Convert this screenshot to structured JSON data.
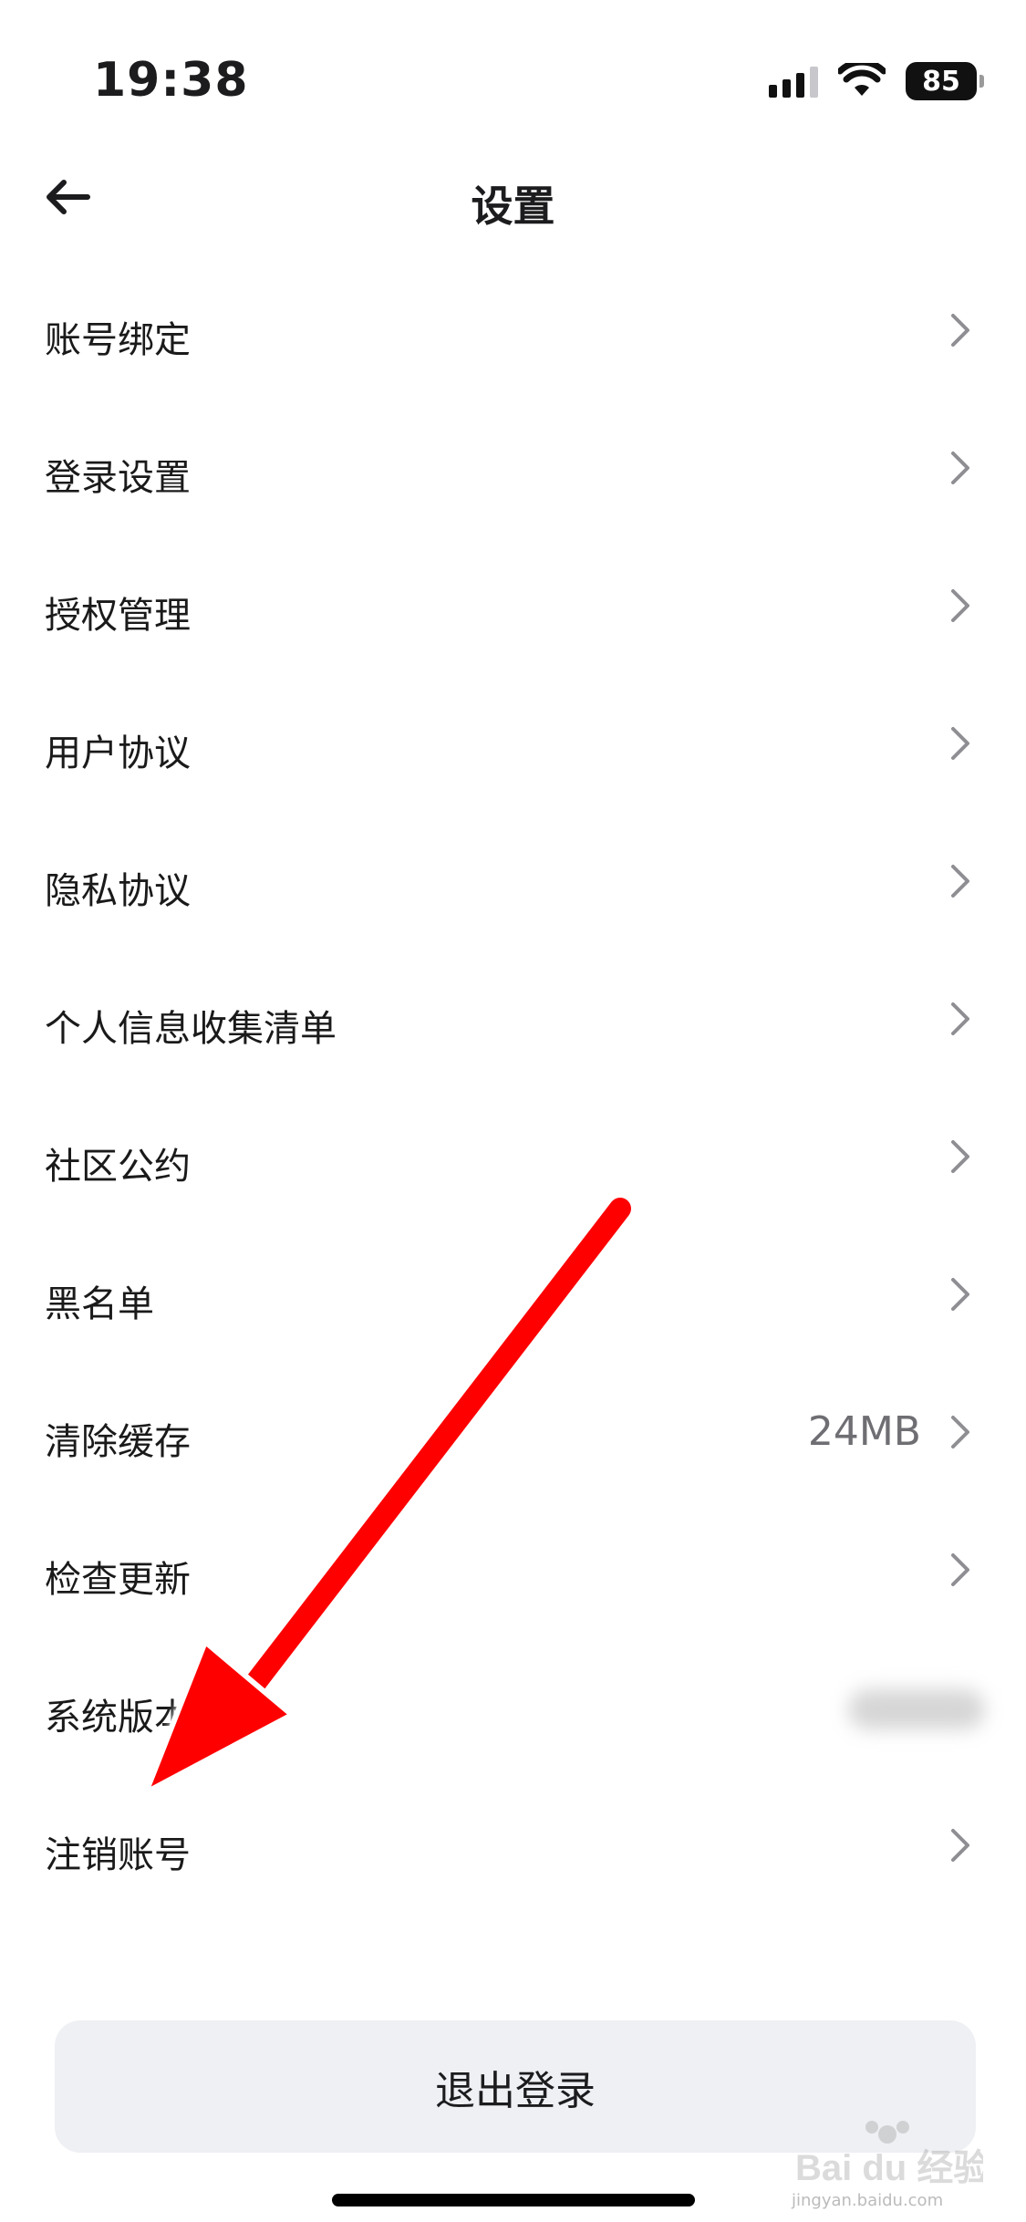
{
  "status_bar": {
    "time": "19:38",
    "battery": "85",
    "icons": [
      "signal-icon",
      "wifi-icon",
      "battery-icon"
    ]
  },
  "nav": {
    "title": "设置",
    "back_icon": "arrow-left-icon"
  },
  "settings_items": [
    {
      "label": "账号绑定",
      "value": "",
      "chevron": true
    },
    {
      "label": "登录设置",
      "value": "",
      "chevron": true
    },
    {
      "label": "授权管理",
      "value": "",
      "chevron": true
    },
    {
      "label": "用户协议",
      "value": "",
      "chevron": true
    },
    {
      "label": "隐私协议",
      "value": "",
      "chevron": true
    },
    {
      "label": "个人信息收集清单",
      "value": "",
      "chevron": true
    },
    {
      "label": "社区公约",
      "value": "",
      "chevron": true
    },
    {
      "label": "黑名单",
      "value": "",
      "chevron": true
    },
    {
      "label": "清除缓存",
      "value": "24MB",
      "chevron": true
    },
    {
      "label": "检查更新",
      "value": "",
      "chevron": true
    },
    {
      "label": "系统版本",
      "value": "",
      "chevron": false
    },
    {
      "label": "注销账号",
      "value": "",
      "chevron": true
    }
  ],
  "logout_label": "退出登录",
  "watermark": {
    "brand": "Bai du 经验",
    "url": "jingyan.baidu.com"
  },
  "colors": {
    "annotation_arrow": "#ff0000",
    "logout_bg": "#eef0f3"
  }
}
